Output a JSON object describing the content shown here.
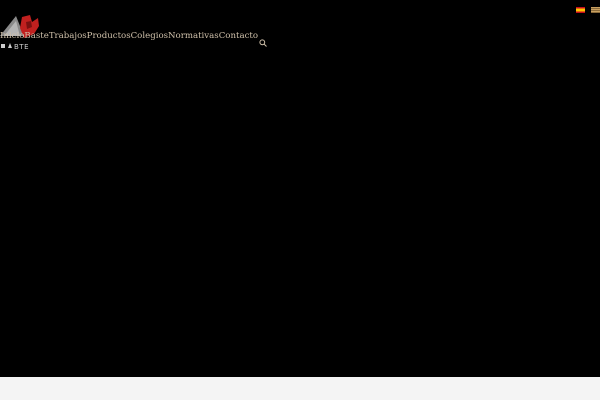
{
  "header": {
    "logo_name": "company-logo",
    "nav": {
      "items": [
        {
          "label": "Inicio"
        },
        {
          "label": "Baste"
        },
        {
          "label": "Trabajos"
        },
        {
          "label": "Productos"
        },
        {
          "label": "Colegios"
        },
        {
          "label": "Normativas"
        },
        {
          "label": "Contacto"
        }
      ],
      "search_icon": "search-icon"
    },
    "languages": [
      {
        "name": "flag-spanish-icon"
      },
      {
        "name": "flag-other-language-icon"
      }
    ]
  },
  "colors": {
    "background": "#000000",
    "nav_text": "#cfc0aa",
    "logo_red": "#c0201f",
    "footer": "#f4f4f4"
  }
}
